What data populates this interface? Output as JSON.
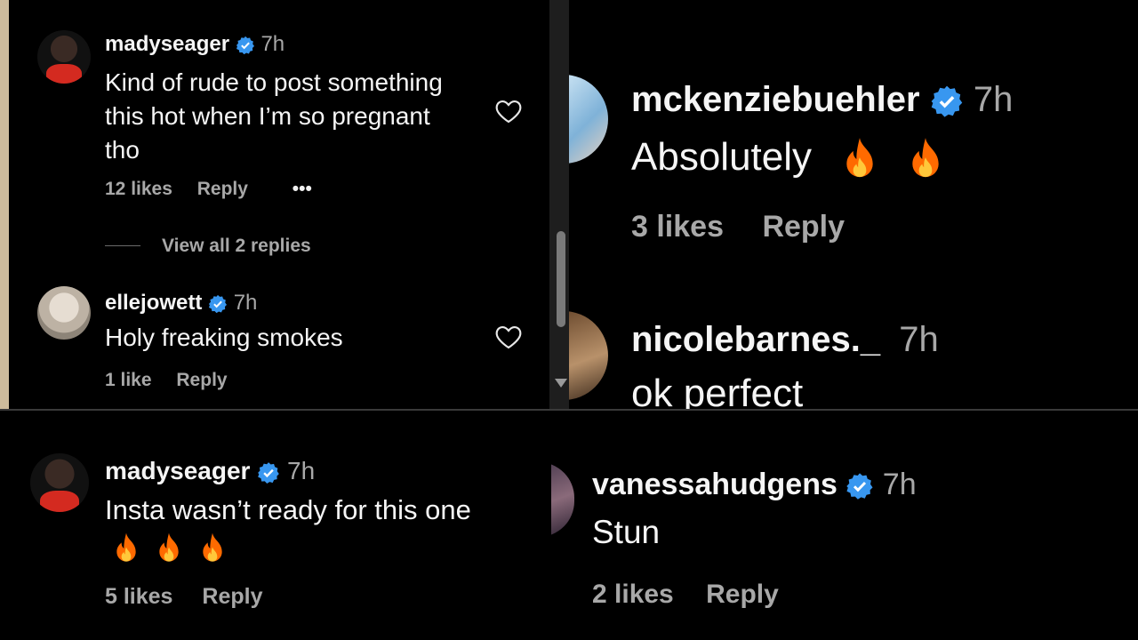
{
  "colors": {
    "verified": "#3897f0",
    "secondary_text": "#a8a8a8",
    "fire": "#ff6a00"
  },
  "panel1": {
    "comment1": {
      "username": "madyseager",
      "time": "7h",
      "text_lines": [
        "Kind of rude to post something",
        "this hot when I’m so pregnant",
        "tho"
      ],
      "likes": "12 likes",
      "reply": "Reply",
      "more": "•••"
    },
    "view_replies": "View all 2 replies",
    "comment2": {
      "username": "ellejowett",
      "time": "7h",
      "text": "Holy freaking smokes",
      "likes": "1 like",
      "reply": "Reply"
    }
  },
  "panel2": {
    "cut_text": "@ ... @ ...",
    "comment1": {
      "username": "mckenziebuehler",
      "time": "7h",
      "text": "Absolutely",
      "emojis": [
        "fire-icon",
        "fire-icon"
      ],
      "likes": "3 likes",
      "reply": "Reply"
    },
    "comment2": {
      "username": "nicolebarnes._",
      "time": "7h",
      "text": "ok perfect"
    }
  },
  "panel3": {
    "comment": {
      "username": "madyseager",
      "time": "7h",
      "text": "Insta wasn’t ready for this one",
      "emojis": [
        "fire-icon",
        "fire-icon",
        "fire-icon"
      ],
      "likes": "5 likes",
      "reply": "Reply"
    }
  },
  "panel4": {
    "comment": {
      "username": "vanessahudgens",
      "time": "7h",
      "text": "Stun",
      "likes": "2 likes",
      "reply": "Reply"
    }
  }
}
